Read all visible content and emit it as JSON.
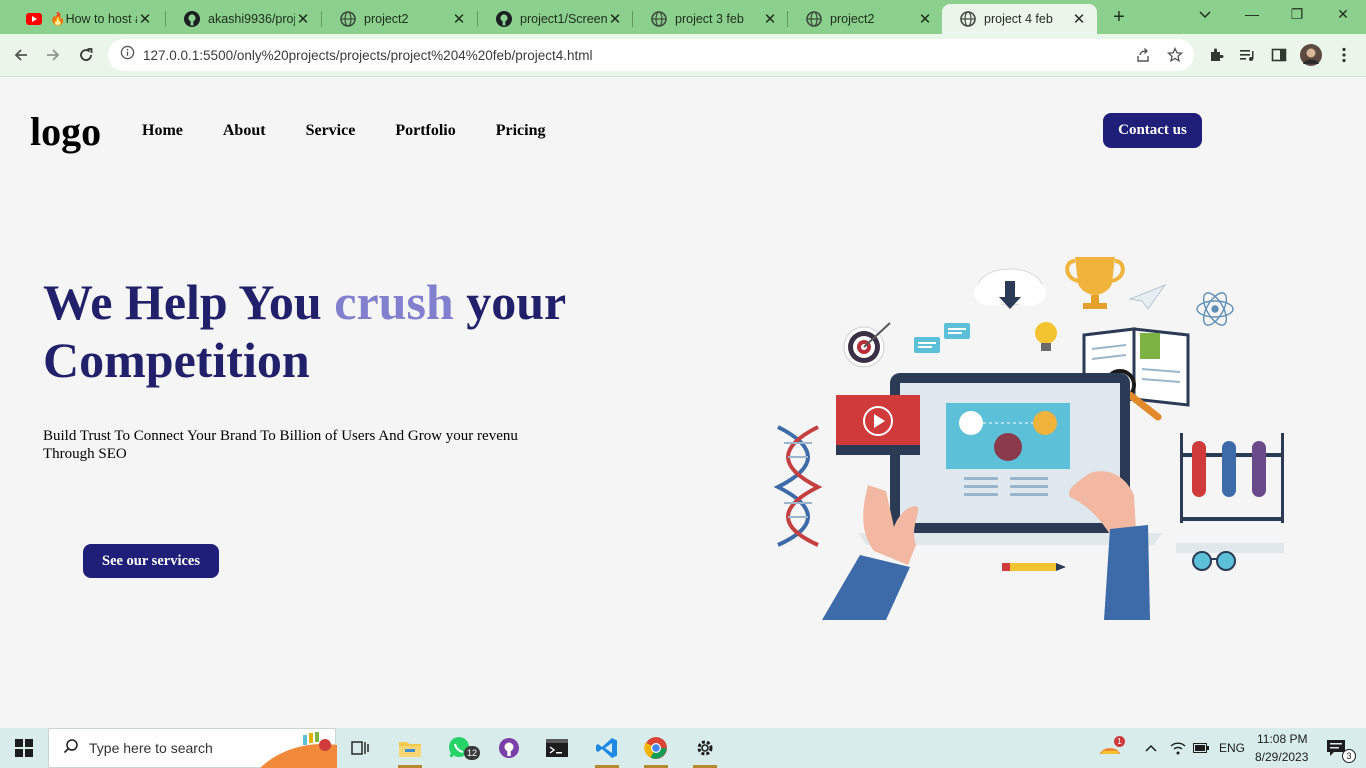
{
  "tabs": [
    {
      "title": "🔥How to host a",
      "icon": "youtube-icon"
    },
    {
      "title": "akashi9936/proje",
      "icon": "github-icon"
    },
    {
      "title": "project2",
      "icon": "globe-icon"
    },
    {
      "title": "project1/Screens",
      "icon": "github-icon"
    },
    {
      "title": "project 3 feb",
      "icon": "globe-icon"
    },
    {
      "title": "project2",
      "icon": "globe-icon"
    },
    {
      "title": "project 4 feb",
      "icon": "globe-icon",
      "active": true
    }
  ],
  "browser": {
    "url": "127.0.0.1:5500/only%20projects/projects/project%204%20feb/project4.html"
  },
  "site": {
    "logo": "logo",
    "nav": [
      "Home",
      "About",
      "Service",
      "Portfolio",
      "Pricing"
    ],
    "contact_label": "Contact us",
    "hero": {
      "title_part1": "We Help You ",
      "title_accent": "crush",
      "title_part2": " your Competition",
      "subtitle": "Build Trust To Connect Your Brand To Billion of Users And Grow your revenu Through SEO",
      "cta_label": "See our services"
    }
  },
  "taskbar": {
    "search_placeholder": "Type here to search",
    "whatsapp_badge": "12",
    "weather_badge": "1",
    "language": "ENG",
    "time": "11:08 PM",
    "date": "8/29/2023",
    "notification_count": "3"
  },
  "colors": {
    "tabstrip": "#8bd08c",
    "toolbar": "#e9f6e9",
    "brand_dark": "#21216b",
    "brand_button": "#1f1f7a",
    "accent": "#8080cf",
    "taskbar": "#d8ecec"
  }
}
